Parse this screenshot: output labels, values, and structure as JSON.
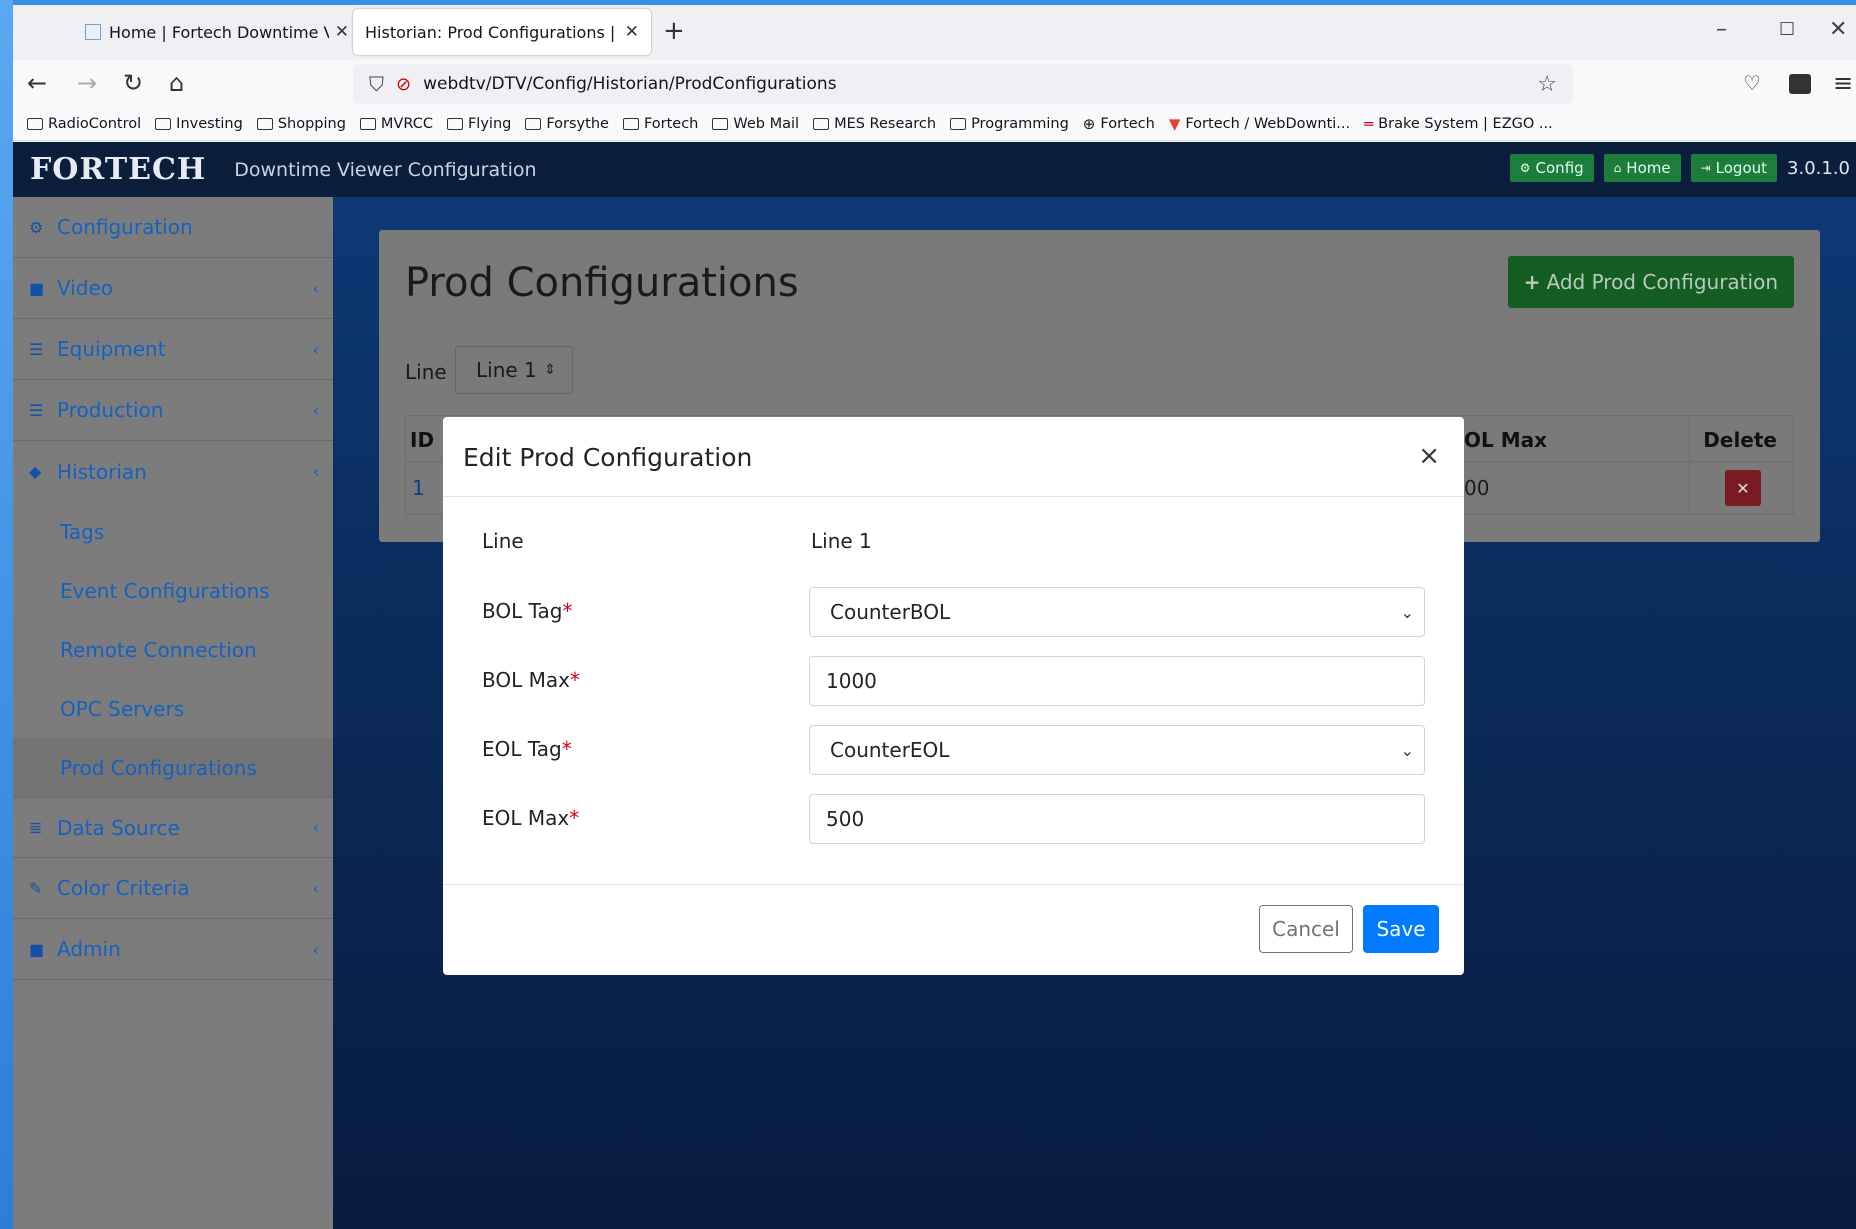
{
  "browser": {
    "tabs": [
      {
        "label": "Home | Fortech Downtime Viewer",
        "active": false
      },
      {
        "label": "Historian: Prod Configurations | Fortech",
        "active": true
      }
    ],
    "url": "webdtv/DTV/Config/Historian/ProdConfigurations",
    "bookmarks": [
      {
        "label": "RadioControl",
        "icon": "folder-icon"
      },
      {
        "label": "Investing",
        "icon": "folder-icon"
      },
      {
        "label": "Shopping",
        "icon": "folder-icon"
      },
      {
        "label": "MVRCC",
        "icon": "folder-icon"
      },
      {
        "label": "Flying",
        "icon": "folder-icon"
      },
      {
        "label": "Forsythe",
        "icon": "folder-icon"
      },
      {
        "label": "Fortech",
        "icon": "folder-icon"
      },
      {
        "label": "Web Mail",
        "icon": "folder-icon"
      },
      {
        "label": "MES Research",
        "icon": "folder-icon"
      },
      {
        "label": "Programming",
        "icon": "folder-icon"
      },
      {
        "label": "Fortech",
        "icon": "globe-icon"
      },
      {
        "label": "Fortech / WebDownti...",
        "icon": "gitlab-icon"
      },
      {
        "label": "Brake System | EZGO ...",
        "icon": "brand-icon"
      }
    ]
  },
  "app": {
    "logo": "FORTECH",
    "title": "Downtime Viewer Configuration",
    "header_buttons": {
      "config": "Config",
      "home": "Home",
      "logout": "Logout"
    },
    "version": "3.0.1.0"
  },
  "sidebar": {
    "configuration": "Configuration",
    "video": "Video",
    "equipment": "Equipment",
    "production": "Production",
    "historian": "Historian",
    "historian_items": [
      "Tags",
      "Event Configurations",
      "Remote Connection",
      "OPC Servers",
      "Prod Configurations"
    ],
    "data_source": "Data Source",
    "color_criteria": "Color Criteria",
    "admin": "Admin"
  },
  "page": {
    "title": "Prod Configurations",
    "add_button": "Add Prod Configuration",
    "line_label": "Line",
    "line_value": "Line 1",
    "table": {
      "col_id": "ID",
      "col_max": "OL Max",
      "col_delete": "Delete",
      "row_id": "1",
      "row_max": "00"
    }
  },
  "modal": {
    "title": "Edit Prod Configuration",
    "close": "×",
    "line_label": "Line",
    "line_value": "Line 1",
    "bol_tag_label": "BOL Tag",
    "bol_tag_value": "CounterBOL",
    "bol_max_label": "BOL Max",
    "bol_max_value": "1000",
    "eol_tag_label": "EOL Tag",
    "eol_tag_value": "CounterEOL",
    "eol_max_label": "EOL Max",
    "eol_max_value": "500",
    "required_mark": "*",
    "cancel": "Cancel",
    "save": "Save"
  }
}
